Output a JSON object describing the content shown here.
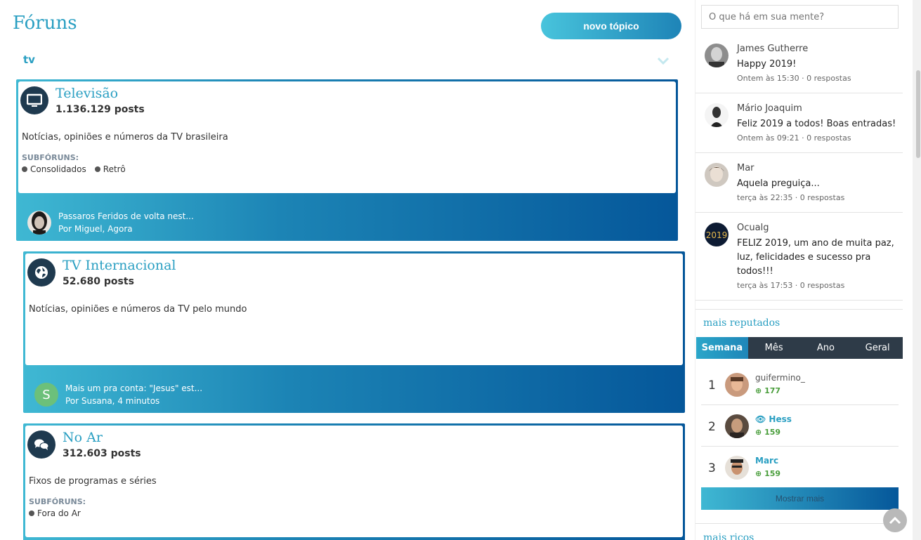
{
  "header": {
    "title": "Fóruns",
    "new_topic_label": "novo tópico"
  },
  "category": {
    "label": "tv"
  },
  "forums": [
    {
      "name": "Televisão",
      "posts": "1.136.129 posts",
      "description": "Notícias, opiniões e números da TV brasileira",
      "subforums_label": "SUBFÓRUNS:",
      "subforums": [
        "Consolidados",
        "Retrô"
      ],
      "last_post": {
        "title": "Passaros Feridos de volta nest...",
        "by": "Por Miguel, Agora"
      }
    },
    {
      "name": "TV Internacional",
      "posts": "52.680 posts",
      "description": "Notícias, opiniões e números da TV pelo mundo",
      "last_post": {
        "title": "Mais um pra conta: \"Jesus\" est...",
        "by": "Por Susana, 4 minutos",
        "avatar_letter": "S"
      }
    },
    {
      "name": "No Ar",
      "posts": "312.603 posts",
      "description": "Fixos de programas e séries",
      "subforums_label": "SUBFÓRUNS:",
      "subforums": [
        "Fora do Ar"
      ]
    }
  ],
  "sidebar": {
    "status_placeholder": "O que há em sua mente?",
    "status_updates": [
      {
        "name": "James Gutherre",
        "text": "Happy 2019!",
        "meta": "Ontem às 15:30 · 0 respostas"
      },
      {
        "name": "Mário Joaquim",
        "text": "Feliz 2019 a todos! Boas entradas!",
        "meta": "Ontem às 09:21 · 0 respostas"
      },
      {
        "name": "Mar",
        "text": "Aquela preguiça...",
        "meta": "terça às 22:35 · 0 respostas"
      },
      {
        "name": "Ocualg",
        "text": "FELIZ 2019, um ano de muita paz, luz, felicidades e sucesso pra todos!!!",
        "meta": "terça às 17:53 · 0 respostas"
      }
    ],
    "reputation": {
      "title": "mais reputados",
      "tabs": [
        "Semana",
        "Mês",
        "Ano",
        "Geral"
      ],
      "active_tab": "Semana",
      "ranks": [
        {
          "pos": "1",
          "name": "guifermino_",
          "score": "177"
        },
        {
          "pos": "2",
          "name": "Hess",
          "score": "159"
        },
        {
          "pos": "3",
          "name": "Marc",
          "score": "159"
        }
      ],
      "show_more": "Mostrar mais"
    },
    "next_section_title": "mais ricos"
  },
  "colors": {
    "accent": "#2a9fc2",
    "dark_navy": "#1f3a4f",
    "gradient_end": "#05579a",
    "rep_green": "#4a9e3c"
  }
}
